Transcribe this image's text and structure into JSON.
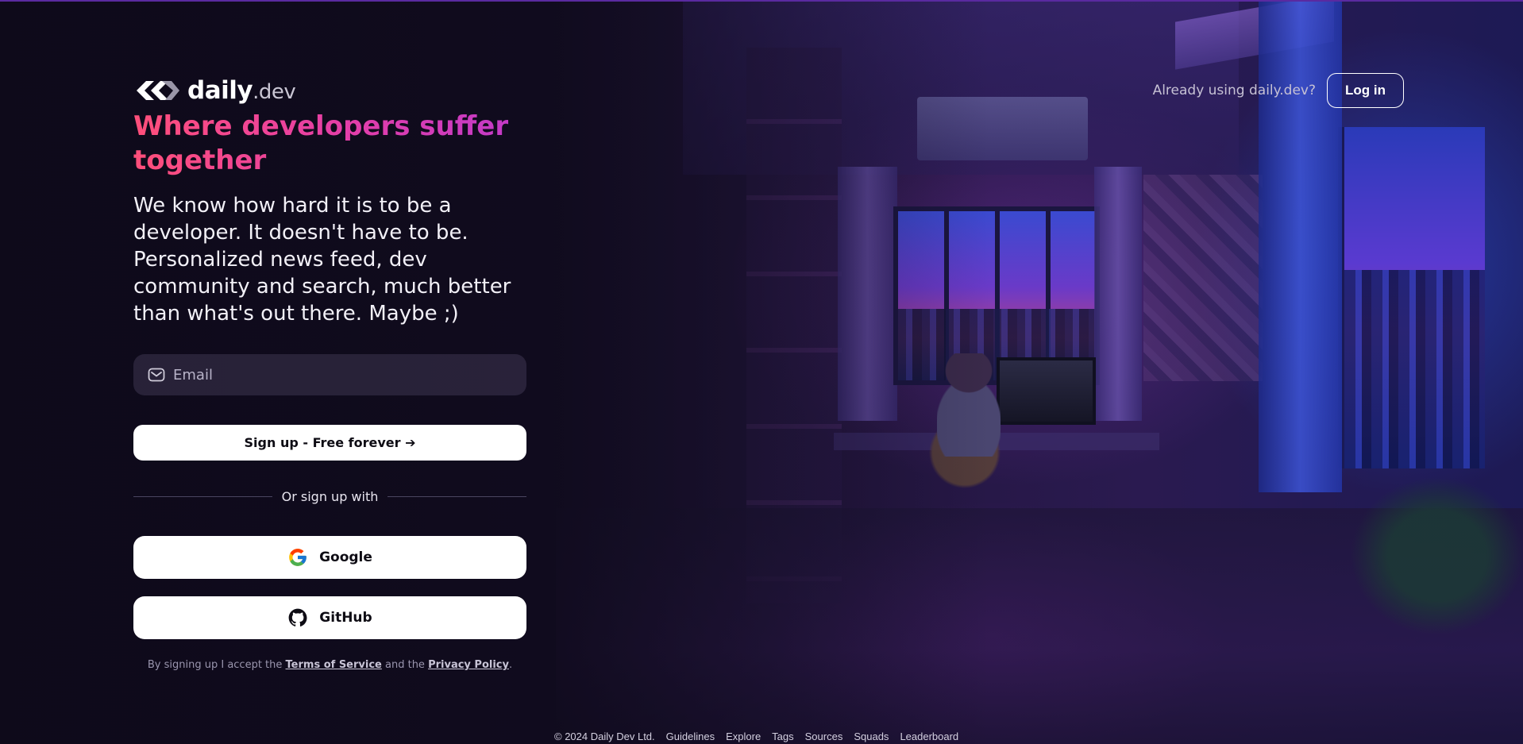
{
  "brand": {
    "name": "daily",
    "ext": ".dev"
  },
  "header": {
    "already_text": "Already using daily.dev?",
    "login_label": "Log in"
  },
  "hero": {
    "headline": "Where developers suffer together",
    "subtitle": "We know how hard it is to be a developer. It doesn't have to be. Personalized news feed, dev community and search, much better than what's out there. Maybe ;)"
  },
  "form": {
    "email_placeholder": "Email",
    "email_value": "",
    "signup_label": "Sign up - Free forever ➔",
    "divider_text": "Or sign up with",
    "google_label": "Google",
    "github_label": "GitHub"
  },
  "terms": {
    "prefix": "By signing up I accept the ",
    "tos": "Terms of Service",
    "middle": " and the ",
    "privacy": "Privacy Policy",
    "suffix": "."
  },
  "footer": {
    "copyright": "© 2024 Daily Dev Ltd.",
    "links": [
      "Guidelines",
      "Explore",
      "Tags",
      "Sources",
      "Squads",
      "Leaderboard"
    ]
  },
  "icons": {
    "logo": "daily-dev-logo-icon",
    "email": "mail-icon",
    "google": "google-icon",
    "github": "github-icon"
  },
  "colors": {
    "headline_gradient_start": "#ff4f7a",
    "headline_gradient_end": "#c33ac8",
    "button_bg": "#ffffff",
    "page_bg": "#140d24"
  }
}
